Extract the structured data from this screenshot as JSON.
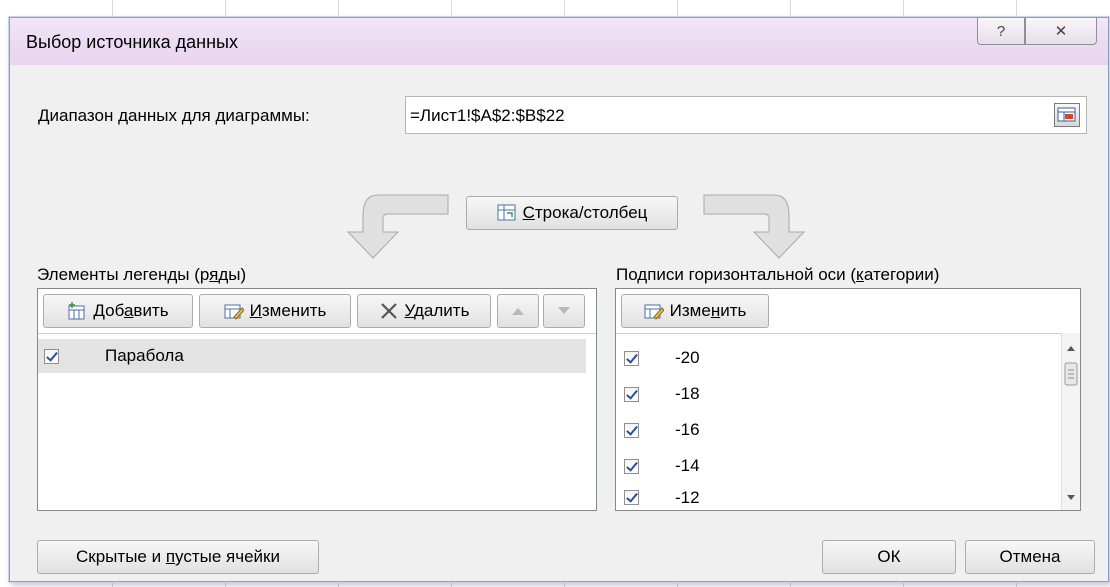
{
  "dialog": {
    "title": "Выбор источника данных",
    "help_glyph": "?",
    "close_glyph": "✕"
  },
  "range": {
    "label_prefix": "Д",
    "label_rest": "иапазон данных для диаграммы:",
    "value": "=Лист1!$A$2:$B$22"
  },
  "switch_button": {
    "hot": "С",
    "rest": "трока/столбец"
  },
  "legend": {
    "label_before": "Элементы легенды (р",
    "label_hot": "я",
    "label_after": "ды)",
    "add": {
      "before": "Доб",
      "hot": "а",
      "after": "вить"
    },
    "edit": {
      "hot": "И",
      "after": "зменить"
    },
    "remove": {
      "hot": "У",
      "after": "далить"
    },
    "items": [
      {
        "label": "Парабола",
        "checked": true
      }
    ]
  },
  "axis": {
    "label_before": "Подписи горизонтальной оси (",
    "label_hot": "к",
    "label_after": "атегории)",
    "edit": {
      "before": "Изме",
      "hot": "н",
      "after": "ить"
    },
    "items": [
      "-20",
      "-18",
      "-16",
      "-14",
      "-12"
    ]
  },
  "footer": {
    "hidden_before": "Скрытые и ",
    "hidden_hot": "п",
    "hidden_after": "устые ячейки",
    "ok": "ОК",
    "cancel": "Отмена"
  },
  "colors": {
    "accent": "#2a4fa0",
    "title_bar": "#ecdcf2",
    "selected_row": "#e3e3e3"
  }
}
